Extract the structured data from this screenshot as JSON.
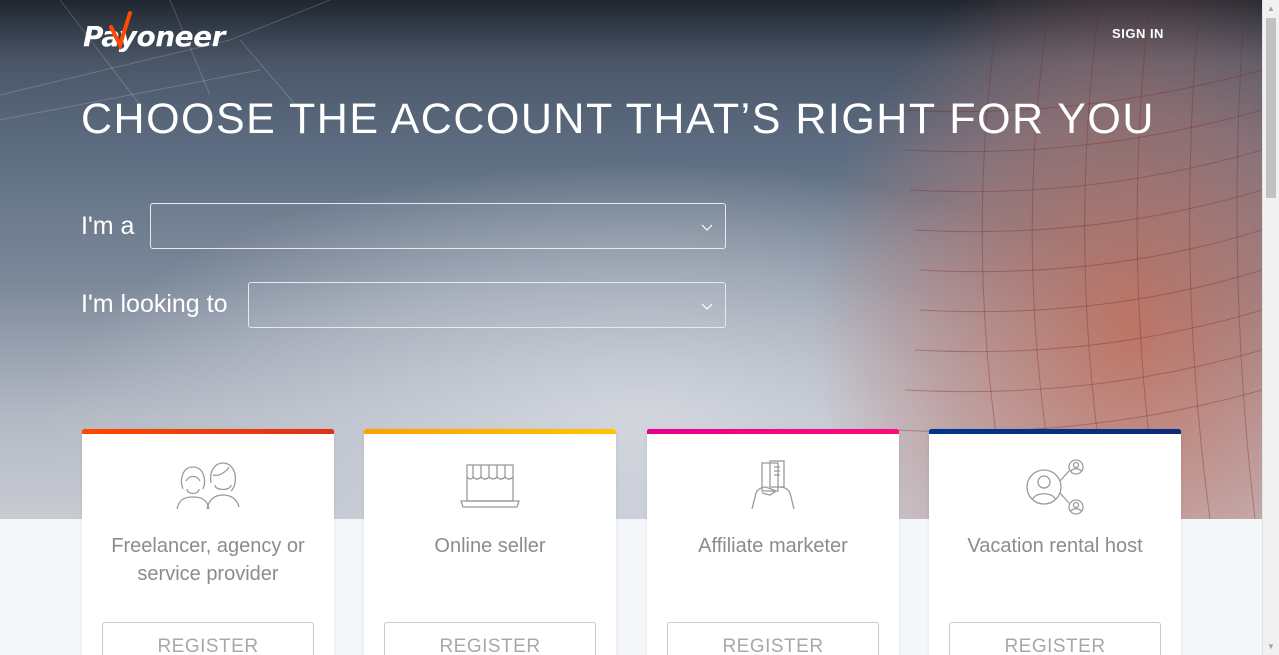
{
  "header": {
    "logo_text": "Payoneer",
    "sign_in_label": "SIGN IN"
  },
  "hero": {
    "headline": "CHOOSE THE ACCOUNT THAT’S RIGHT FOR YOU"
  },
  "form": {
    "im_a_label": "I'm a",
    "im_a_value": "",
    "looking_label": "I'm looking to",
    "looking_value": ""
  },
  "colors": {
    "freelancer_accent": "#ff4800",
    "seller_accent": "#ffb400",
    "affiliate_accent": "#e6008c",
    "vacation_accent": "#00358c",
    "logo_accent": "#ff4800"
  },
  "cards": [
    {
      "title": "Freelancer, agency or service provider",
      "button": "REGISTER",
      "icon": "freelancer-people-icon"
    },
    {
      "title": "Online seller",
      "button": "REGISTER",
      "icon": "storefront-laptop-icon"
    },
    {
      "title": "Affiliate marketer",
      "button": "REGISTER",
      "icon": "hand-holding-phone-icon"
    },
    {
      "title": "Vacation rental host",
      "button": "REGISTER",
      "icon": "network-users-icon"
    }
  ]
}
